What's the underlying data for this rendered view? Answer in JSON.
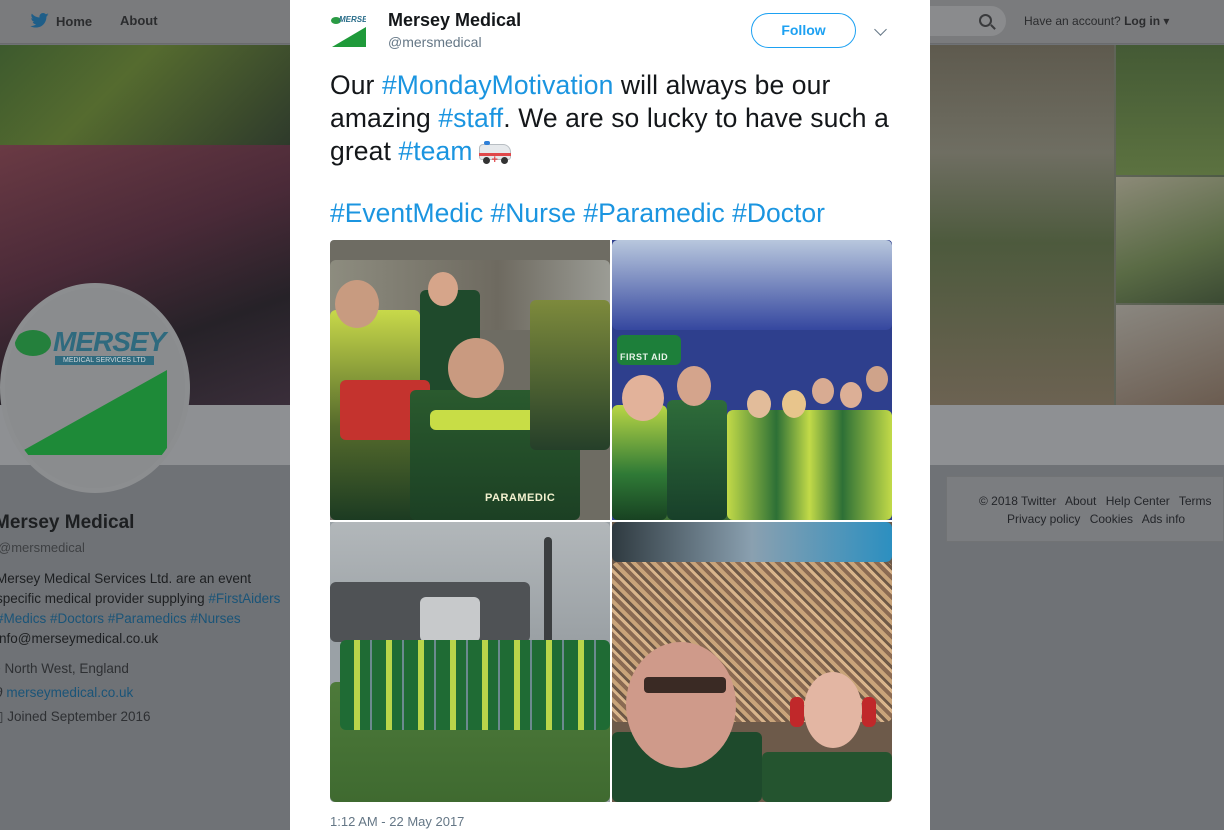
{
  "topbar": {
    "home_label": "Home",
    "about_label": "About",
    "login_prefix": "Have an account?",
    "login_label": "Log in"
  },
  "profile": {
    "name": "Mersey Medical",
    "handle": "@mersmedical",
    "bio_start": "Mersey Medical Services Ltd. are an event specific medical provider supplying",
    "bio_tags": "#FirstAiders #Medics #Doctors #Paramedics #Nurses",
    "bio_email": "info@merseymedical.co.uk",
    "location": "North West, England",
    "website": "merseymedical.co.uk",
    "joined": "Joined September 2016",
    "avatar_logo_word": "MERSEY",
    "avatar_logo_sub": "MEDICAL SERVICES LTD"
  },
  "footer": {
    "links": [
      "© 2018 Twitter",
      "About",
      "Help Center",
      "Terms",
      "Privacy policy",
      "Cookies",
      "Ads info"
    ]
  },
  "tweet": {
    "author_name": "Mersey Medical",
    "author_handle": "@mersmedical",
    "follow_label": "Follow",
    "text_part1": "Our ",
    "tag_monday": "#MondayMotivation",
    "text_part2": " will always be our amazing ",
    "tag_staff": "#staff",
    "text_part3": ". We are so lucky to have such a great ",
    "tag_team": "#team",
    "hashtags_line": "#EventMedic #Nurse #Paramedic #Doctor",
    "photo_label": "PARAMEDIC",
    "photo_sign": "FIRST AID",
    "timestamp": "1:12 AM - 22 May 2017"
  },
  "colors": {
    "accent": "#1da1f2",
    "hashtag": "#1b95e0",
    "muted": "#657786",
    "brand_green": "#1f9a3a"
  }
}
